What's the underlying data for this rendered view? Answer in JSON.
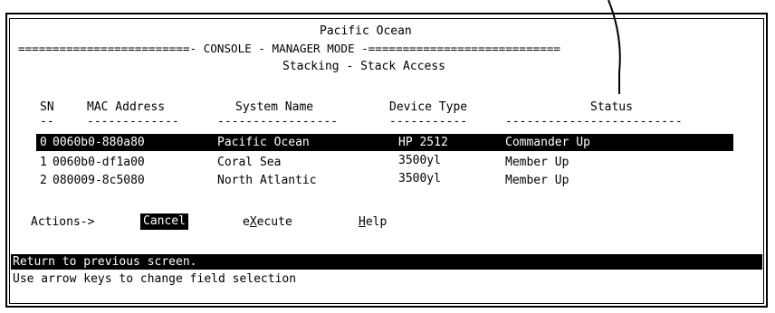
{
  "console": {
    "switch_name": "Pacific Ocean",
    "mode_line": "=========================- CONSOLE - MANAGER MODE -============================",
    "screen_title": "Stacking - Stack Access"
  },
  "table": {
    "headers": [
      "SN",
      "MAC Address",
      "System Name",
      "Device Type",
      "Status"
    ],
    "underlines": [
      "--",
      "-------------",
      "-----------------",
      "-----------",
      "-------------------------"
    ],
    "rows": [
      {
        "sn": "0",
        "mac": "0060b0-880a80",
        "name": "Pacific Ocean",
        "type": "HP 2512",
        "status": "Commander Up"
      },
      {
        "sn": "1",
        "mac": "0060b0-df1a00",
        "name": "Coral Sea",
        "type": "3500yl",
        "status": "Member Up"
      },
      {
        "sn": "2",
        "mac": "080009-8c5080",
        "name": "North Atlantic",
        "type": "3500yl",
        "status": "Member Up"
      }
    ]
  },
  "actions": {
    "prefix": "Actions->",
    "cancel": "Cancel",
    "execute_pre": "e",
    "execute_key": "X",
    "execute_post": "ecute",
    "help_key": "H",
    "help_post": "elp"
  },
  "status_bar": {
    "help_line": "Return to previous screen.",
    "hint_line": "Use arrow keys to change field selection"
  }
}
